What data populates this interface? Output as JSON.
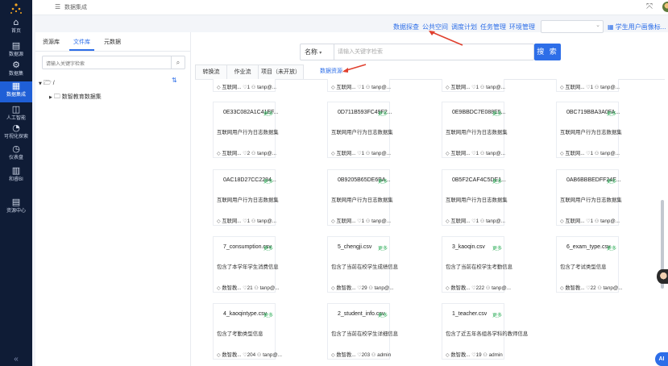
{
  "app": {
    "breadcrumb": "数据集成"
  },
  "sidebar": {
    "items": [
      {
        "label": "首页",
        "icon": "home-icon"
      },
      {
        "label": "数据源",
        "icon": "database-icon"
      },
      {
        "label": "数据集",
        "icon": "gear-icon"
      },
      {
        "label": "数据集成",
        "icon": "grid-icon"
      },
      {
        "label": "人工智能",
        "icon": "ai-icon"
      },
      {
        "label": "可视化探索",
        "icon": "chart-icon"
      },
      {
        "label": "仪表盘",
        "icon": "dashboard-icon"
      },
      {
        "label": "和睿BI",
        "icon": "bi-icon"
      },
      {
        "label": "资源中心",
        "icon": "resource-icon"
      }
    ],
    "collapse": "«"
  },
  "left_panel": {
    "tabs": [
      "资源库",
      "文件库",
      "元数据"
    ],
    "search_placeholder": "请输入关键字检索",
    "tree": {
      "root": "/",
      "child": "数智教育数据集"
    }
  },
  "top_nav": {
    "links": [
      "数据探查",
      "公共空间",
      "调度计划",
      "任务管理",
      "环境管理"
    ],
    "select_value": "",
    "portrait": "学生用户画像标..."
  },
  "search_bar": {
    "field": "名称",
    "placeholder": "请输入关键字检索",
    "button": "搜 索"
  },
  "work_tabs": [
    "转换流",
    "作业流",
    "项目（未开放）",
    "数据资源"
  ],
  "cards": [
    {
      "title": "",
      "more": "",
      "desc": "",
      "source": "互联网...",
      "count": "1",
      "user": "tanp@...",
      "row": 0
    },
    {
      "title": "",
      "more": "",
      "desc": "",
      "source": "互联网...",
      "count": "1",
      "user": "tanp@...",
      "row": 0
    },
    {
      "title": "",
      "more": "",
      "desc": "",
      "source": "互联网...",
      "count": "1",
      "user": "tanp@...",
      "row": 0
    },
    {
      "title": "",
      "more": "",
      "desc": "",
      "source": "互联网...",
      "count": "1",
      "user": "tanp@...",
      "row": 0
    },
    {
      "title": "0E33C082A1C41EF...",
      "more": "更多",
      "desc": "互联网用户行为日志数据集",
      "source": "互联网...",
      "count": "2",
      "user": "tanp@...",
      "row": 1
    },
    {
      "title": "0D711B593FC49F2...",
      "more": "更多",
      "desc": "互联网用户行为日志数据集",
      "source": "互联网...",
      "count": "1",
      "user": "tanp@...",
      "row": 1
    },
    {
      "title": "0E9BBDC7E088E5...",
      "more": "更多",
      "desc": "互联网用户行为日志数据集",
      "source": "互联网...",
      "count": "1",
      "user": "tanp@...",
      "row": 1
    },
    {
      "title": "0BC719BBA3A0FA...",
      "more": "更多",
      "desc": "互联网用户行为日志数据集",
      "source": "互联网...",
      "count": "1",
      "user": "tanp@...",
      "row": 1
    },
    {
      "title": "0AC18D27CC2284...",
      "more": "更多",
      "desc": "互联网用户行为日志数据集",
      "source": "互联网...",
      "count": "1",
      "user": "tanp@...",
      "row": 2
    },
    {
      "title": "0B9205B65DE6BA...",
      "more": "更多",
      "desc": "互联网用户行为日志数据集",
      "source": "互联网...",
      "count": "1",
      "user": "tanp@...",
      "row": 2
    },
    {
      "title": "0B5F2CAF4C5DE1...",
      "more": "更多",
      "desc": "互联网用户行为日志数据集",
      "source": "互联网...",
      "count": "1",
      "user": "tanp@...",
      "row": 2
    },
    {
      "title": "0AB6BBBEDFF24E...",
      "more": "更多",
      "desc": "互联网用户行为日志数据集",
      "source": "互联网...",
      "count": "1",
      "user": "tanp@...",
      "row": 2
    },
    {
      "title": "7_consumption.csv",
      "more": "更多",
      "desc": "包含了本学年学生消费信息",
      "source": "数智教...",
      "count": "21",
      "user": "tanp@...",
      "row": 3
    },
    {
      "title": "5_chengji.csv",
      "more": "更多",
      "desc": "包含了当前在校学生成绩信息",
      "source": "数智教...",
      "count": "29",
      "user": "tanp@...",
      "row": 3
    },
    {
      "title": "3_kaoqin.csv",
      "more": "更多",
      "desc": "包含了当前在校学生考勤信息",
      "source": "数智教...",
      "count": "222",
      "user": "tanp@...",
      "row": 3
    },
    {
      "title": "6_exam_type.csv",
      "more": "更多",
      "desc": "包含了考试类型信息",
      "source": "数智教...",
      "count": "22",
      "user": "tanp@...",
      "row": 3
    },
    {
      "title": "4_kaoqintype.csv",
      "more": "更多",
      "desc": "包含了考勤类型信息",
      "source": "数智教...",
      "count": "204",
      "user": "tanp@...",
      "row": 4
    },
    {
      "title": "2_student_info.csv",
      "more": "更多",
      "desc": "包含了当前在校学生详细信息",
      "source": "数智教...",
      "count": "203",
      "user": "admin",
      "row": 4
    },
    {
      "title": "1_teacher.csv",
      "more": "更多",
      "desc": "包含了近五年各组各学科的教师信息",
      "source": "数智教...",
      "count": "19",
      "user": "admin",
      "row": 4
    }
  ],
  "assistant": {
    "label": "AI"
  }
}
